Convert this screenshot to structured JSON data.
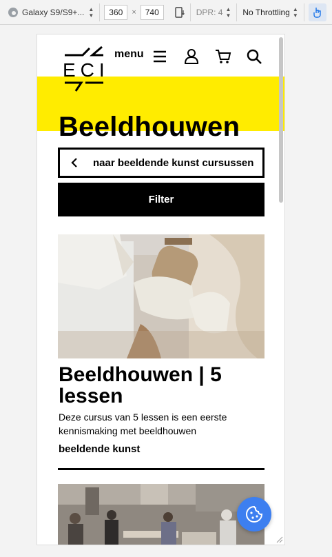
{
  "devtools": {
    "device_name": "Galaxy S9/S9+...",
    "width": "360",
    "height": "740",
    "times": "×",
    "dpr": "DPR: 4",
    "throttling": "No Throttling"
  },
  "site": {
    "logo_text": "ECI",
    "menu_label": "menu",
    "page_title": "Beeldhouwen",
    "back_link": "naar beeldende kunst cursussen",
    "filter_label": "Filter",
    "accent_color": "#ffec00"
  },
  "card": {
    "title": "Beeldhouwen | 5 lessen",
    "description": "Deze cursus van 5 lessen is een eerste kennismaking met beeldhouwen",
    "category": "beeldende kunst"
  },
  "icons": {
    "nav": [
      "hamburger-icon",
      "user-icon",
      "cart-icon",
      "search-icon"
    ],
    "cookie": "cookie-icon"
  }
}
